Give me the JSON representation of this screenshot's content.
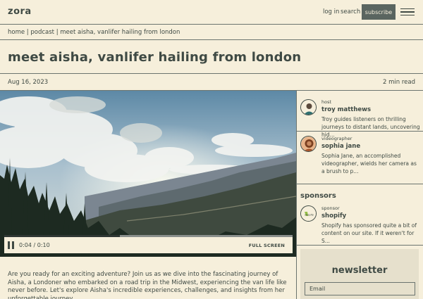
{
  "header": {
    "logo": "zora",
    "login": "log in",
    "search": "search",
    "subscribe": "subscribe"
  },
  "breadcrumb": "home | podcast | meet aisha, vanlifer hailing from london",
  "article": {
    "title": "meet aisha, vanlifer hailing from london",
    "date": "Aug 16, 2023",
    "read_time": "2 min read",
    "intro": "Are you ready for an exciting adventure? Join us as we dive into the fascinating journey of Aisha, a Londoner who embarked on a road trip in the Midwest, experiencing the van life like never before. Let's explore Aisha's incredible experiences, challenges, and insights from her unforgettable journey."
  },
  "video": {
    "time": "0:04 / 0:10",
    "progress": 0.4,
    "fullscreen": "FULL SCREEN"
  },
  "people": [
    {
      "role": "host",
      "name": "troy matthews",
      "bio": "Troy guides listeners on thrilling journeys to distant lands, uncovering hid..."
    },
    {
      "role": "videographer",
      "name": "sophia jane",
      "bio": "Sophia Jane, an accomplished videographer, wields her camera as a brush to p..."
    }
  ],
  "sponsors": {
    "heading": "sponsors",
    "items": [
      {
        "role": "sponsor",
        "name": "shopify",
        "logo_text": "shopify",
        "bio": "Shopify has sponsored quite a bit of content on our site. If it weren't for S..."
      }
    ]
  },
  "newsletter": {
    "title": "newsletter",
    "placeholder": "Email"
  },
  "colors": {
    "background": "#f6efdb",
    "text": "#3f4a44",
    "button": "#5a6560"
  }
}
